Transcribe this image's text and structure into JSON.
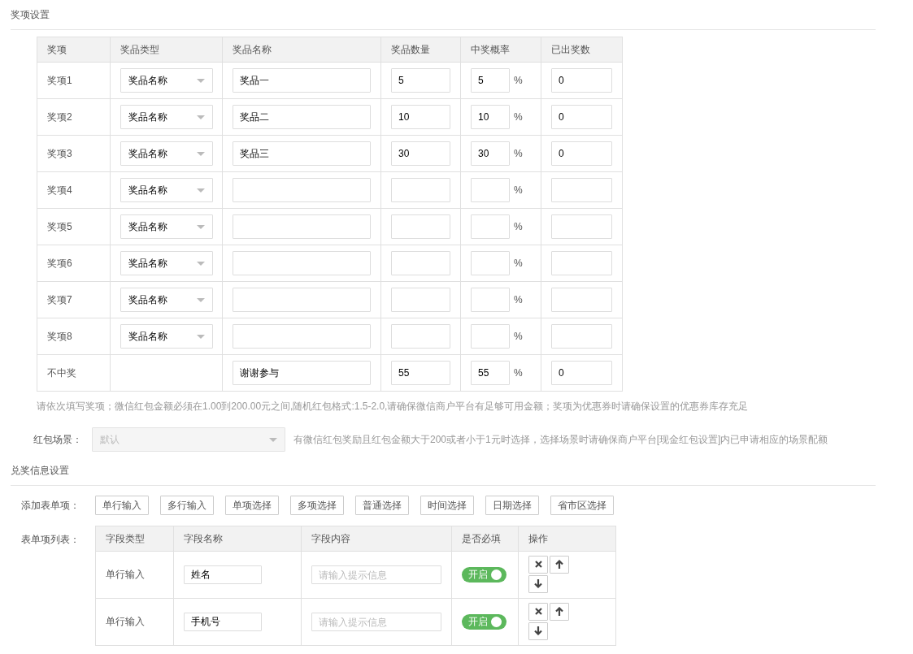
{
  "prize_section": {
    "title": "奖项设置"
  },
  "prize_table": {
    "columns": [
      "奖项",
      "奖品类型",
      "奖品名称",
      "奖品数量",
      "中奖概率",
      "已出奖数"
    ],
    "rows": [
      {
        "item": "奖项1",
        "prize_type": "奖品名称",
        "prize_name": "奖品一",
        "quantity": "5",
        "probability": "5",
        "unit": "%",
        "issued": "0"
      },
      {
        "item": "奖项2",
        "prize_type": "奖品名称",
        "prize_name": "奖品二",
        "quantity": "10",
        "probability": "10",
        "unit": "%",
        "issued": "0"
      },
      {
        "item": "奖项3",
        "prize_type": "奖品名称",
        "prize_name": "奖品三",
        "quantity": "30",
        "probability": "30",
        "unit": "%",
        "issued": "0"
      },
      {
        "item": "奖项4",
        "prize_type": "奖品名称",
        "unit": "%"
      },
      {
        "item": "奖项5",
        "prize_type": "奖品名称",
        "unit": "%"
      },
      {
        "item": "奖项6",
        "prize_type": "奖品名称",
        "unit": "%"
      },
      {
        "item": "奖项7",
        "prize_type": "奖品名称",
        "unit": "%"
      },
      {
        "item": "奖项8",
        "prize_type": "奖品名称",
        "unit": "%"
      },
      {
        "item": "不中奖",
        "prize_name": "谢谢参与",
        "quantity": "55",
        "probability": "55",
        "unit": "%",
        "issued": "0"
      }
    ]
  },
  "note": "请依次填写奖项；微信红包金额必须在1.00到200.00元之间,随机红包格式:1.5-2.0,请确保微信商户平台有足够可用金额；奖项为优惠券时请确保设置的优惠券库存充足",
  "scene": {
    "label": "红包场景：",
    "value": "默认",
    "disabled": true,
    "hint": "有微信红包奖励且红包金额大于200或者小于1元时选择，选择场景时请确保商户平台[现金红包设置]内已申请相应的场景配额"
  },
  "redeem_section": {
    "title": "兑奖信息设置"
  },
  "add_fields": {
    "label": "添加表单项：",
    "buttons": [
      "单行输入",
      "多行输入",
      "单项选择",
      "多项选择",
      "普通选择",
      "时间选择",
      "日期选择",
      "省市区选择"
    ]
  },
  "field_list": {
    "label": "表单项列表：",
    "columns": [
      "字段类型",
      "字段名称",
      "字段内容",
      "是否必填",
      "操作"
    ],
    "rows": [
      {
        "type": "单行输入",
        "name": "姓名",
        "placeholder": "请输入提示信息",
        "required_label": "开启",
        "required": true
      },
      {
        "type": "单行输入",
        "name": "手机号",
        "placeholder": "请输入提示信息",
        "required_label": "开启",
        "required": true
      }
    ]
  }
}
